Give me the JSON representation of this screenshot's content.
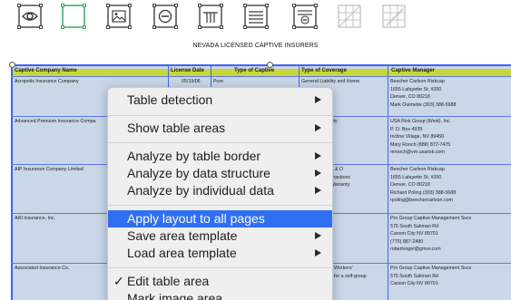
{
  "toolbar": {
    "tools": [
      {
        "icon": "eye-icon"
      },
      {
        "icon": "select-area-icon",
        "active": true
      },
      {
        "icon": "image-icon"
      },
      {
        "icon": "no-entry-icon"
      },
      {
        "icon": "columns-icon"
      },
      {
        "icon": "rows-icon"
      },
      {
        "icon": "remove-icon"
      },
      {
        "icon": "grid-icon",
        "disabled": true
      },
      {
        "icon": "grid-edit-icon",
        "disabled": true
      }
    ],
    "accent": "#2ea44f"
  },
  "document": {
    "title": "NEVADA LICENSED CAPTIVE INSURERS",
    "headers": [
      "Captive Company Name",
      "License Date",
      "Type of Captive",
      "Type of Coverage",
      "Captive Manager"
    ],
    "rows": [
      {
        "company": "Acropolis Insurance Company",
        "date": "05/19/06",
        "type": "Pure",
        "coverage": "General Liability and Home",
        "manager": [
          "Beecher Carlson Riskcap",
          "1655 Lafayette St, #200",
          "Denver, CO 80218",
          "Mark Ouimette (303) 388-5688"
        ]
      },
      {
        "company": "Advanced Premium Insurance Compa",
        "coverage": "ility",
        "manager": [
          "USA Risk Group (West), Inc.",
          "P. O. Box 4939",
          "Incline Village, NV 89450",
          "Mary Rooch (888) 872-7475",
          "mrooch@vm.usarisk.com"
        ]
      },
      {
        "company": "AIP Insurance Company Limited",
        "coverage": [
          "E & O",
          "Practices",
          "Warranty"
        ],
        "manager": [
          "Beecher Carlson Riskcap",
          "1655 Lafayette St, #200",
          "Denver, CO 80218",
          "Richard Poling (303) 388-5688",
          "rpoling@beechercarlson.com"
        ]
      },
      {
        "company": "ARI Insurance, Inc.",
        "manager": [
          "Pro Group Captive Management Svcs",
          "575 South Saliman Rd",
          "Carson City NV 89701",
          "(775) 887-2480",
          "robertvogel@gmvv.com"
        ]
      },
      {
        "company": "Associated Insurance Co.",
        "coverage": [
          "Workers'",
          "for a self-group"
        ],
        "manager": [
          "Pro Group Captive Management Svcs",
          "575 South Saliman Rd",
          "Carson City NV 89701"
        ]
      }
    ]
  },
  "menu": {
    "items": [
      {
        "label": "Table detection",
        "submenu": true
      },
      {
        "label": "Show table areas",
        "submenu": true
      },
      {
        "label": "Analyze by table border",
        "submenu": true
      },
      {
        "label": "Analyze by data structure",
        "submenu": true
      },
      {
        "label": "Analyze by individual data",
        "submenu": true
      },
      {
        "label": "Apply layout to all pages",
        "selected": true
      },
      {
        "label": "Save area template",
        "submenu": true
      },
      {
        "label": "Load area template",
        "submenu": true
      },
      {
        "label": "Edit table area",
        "checked": true,
        "check_glyph": "✓"
      },
      {
        "label": "Mark image area"
      }
    ],
    "highlight_color": "#2f6ff1"
  }
}
